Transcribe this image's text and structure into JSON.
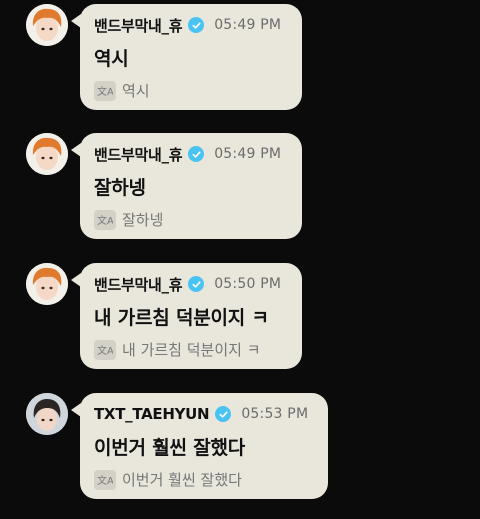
{
  "messages": [
    {
      "sender": "밴드부막내_휴",
      "time": "05:49 PM",
      "text": "역시",
      "translation": "역시",
      "avatar": "avatar-orange-hair"
    },
    {
      "sender": "밴드부막내_휴",
      "time": "05:49 PM",
      "text": "잘하넹",
      "translation": "잘하넹",
      "avatar": "avatar-orange-hair"
    },
    {
      "sender": "밴드부막내_휴",
      "time": "05:50 PM",
      "text": "내 가르침 덕분이지 ㅋ",
      "translation": "내 가르침 덕분이지 ㅋ",
      "avatar": "avatar-orange-hair"
    },
    {
      "sender": "TXT_TAEHYUN",
      "time": "05:53 PM",
      "text": "이번거 훨씬 잘했다",
      "translation": "이번거 훨씬 잘했다",
      "avatar": "avatar-dark-hair"
    }
  ],
  "colors": {
    "background": "#0b0b0b",
    "bubble": "#e9e6dc",
    "verified": "#49c4f2"
  },
  "icons": {
    "verified": "verified-badge-icon",
    "translate": "translate-icon"
  }
}
